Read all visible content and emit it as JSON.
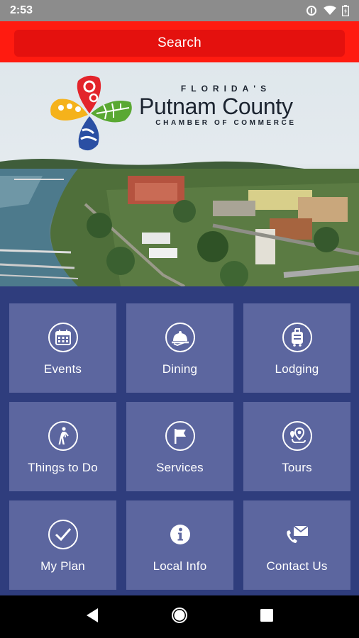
{
  "status_bar": {
    "time": "2:53"
  },
  "search": {
    "label": "Search"
  },
  "logo": {
    "line1": "FLORIDA'S",
    "line2": "Putnam County",
    "line3": "CHAMBER OF COMMERCE"
  },
  "tiles": [
    {
      "label": "Events",
      "icon": "calendar-icon"
    },
    {
      "label": "Dining",
      "icon": "food-tray-icon"
    },
    {
      "label": "Lodging",
      "icon": "luggage-icon"
    },
    {
      "label": "Things to Do",
      "icon": "walking-person-icon"
    },
    {
      "label": "Services",
      "icon": "flag-icon"
    },
    {
      "label": "Tours",
      "icon": "map-pin-route-icon"
    },
    {
      "label": "My Plan",
      "icon": "checkmark-icon"
    },
    {
      "label": "Local Info",
      "icon": "info-icon"
    },
    {
      "label": "Contact Us",
      "icon": "phone-envelope-icon"
    }
  ],
  "colors": {
    "status_bar": "#8c8c8c",
    "search_bar": "#ff1b10",
    "search_button": "#e4110e",
    "grid_background": "#2f3d7d",
    "tile": "#5c669f"
  }
}
